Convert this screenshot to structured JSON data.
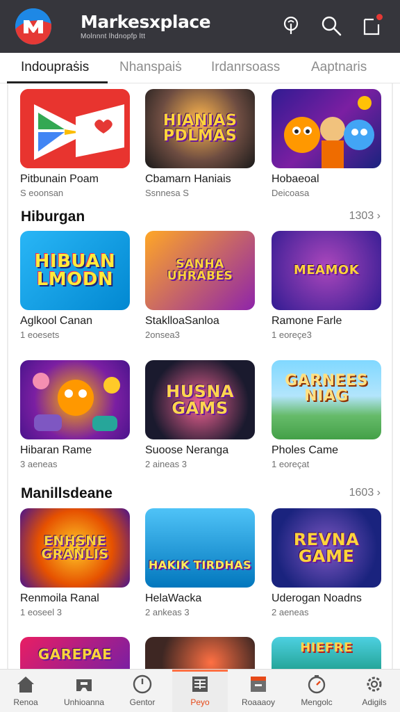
{
  "header": {
    "app_title": "Markesxplace",
    "app_subtitle": "Molnnnt lhdnopfp ltt",
    "icons": [
      "logo-icon",
      "pin-icon",
      "search-icon",
      "notification-icon"
    ]
  },
  "tabs": [
    {
      "label": "Indoupraṡis",
      "active": true
    },
    {
      "label": "Nhanspaiṡ",
      "active": false
    },
    {
      "label": "Irdanrsoass",
      "active": false
    },
    {
      "label": "Aaptnaris",
      "active": false
    }
  ],
  "rows": [
    {
      "cards": [
        {
          "title": "Pitbunain Poam",
          "sub": "S eoonsan",
          "art": ""
        },
        {
          "title": "Cbamarn Haniais",
          "sub": "Ssnnesa S",
          "art": "HIANIAS PDLMAS"
        },
        {
          "title": "Hobaeoal",
          "sub": "Deicoasa",
          "art": ""
        }
      ]
    },
    {
      "section": {
        "title": "Hiburgan",
        "more": "1303 ›"
      },
      "cards": [
        {
          "title": "Aglkool Canan",
          "sub": "1 eoesets",
          "art": "HIBUAN LMODN"
        },
        {
          "title": "StaklloaSanloa",
          "sub": "2onsea3",
          "art": "SANHA UHRABES"
        },
        {
          "title": "Ramone Farle",
          "sub": "1 eoreçe3",
          "art": "MEAMOK"
        }
      ]
    },
    {
      "cards": [
        {
          "title": "Hibaran Rame",
          "sub": "3 aeneas",
          "art": ""
        },
        {
          "title": "Suoose Neranga",
          "sub": "2 aineas 3",
          "art": "HUSNA GAMS"
        },
        {
          "title": "Pholes Came",
          "sub": "1 eoreçat",
          "art": "GARNEES NIAG"
        }
      ]
    },
    {
      "section": {
        "title": "Manillsdeane",
        "more": "1603 ›"
      },
      "cards": [
        {
          "title": "Renmoila Ranal",
          "sub": "1 eoseel 3",
          "art": "ENHSNE GRANLIS"
        },
        {
          "title": "HelaWacka",
          "sub": "2 ankeas 3",
          "art": "HAKIK TIRDHAS"
        },
        {
          "title": "Uderogan Noadns",
          "sub": "2 aeneas",
          "art": "REVNA GAME"
        }
      ]
    },
    {
      "cards": [
        {
          "title": "",
          "sub": "",
          "art": "GAREPAE"
        },
        {
          "title": "",
          "sub": "",
          "art": ""
        },
        {
          "title": "",
          "sub": "",
          "art": "HIEFRE"
        }
      ]
    }
  ],
  "bottom_nav": [
    {
      "label": "Renoa",
      "icon": "home-icon",
      "active": false
    },
    {
      "label": "Unhioanna",
      "icon": "controller-icon",
      "active": false
    },
    {
      "label": "Gentor",
      "icon": "clock-icon",
      "active": false
    },
    {
      "label": "Peyo",
      "icon": "list-icon",
      "active": true
    },
    {
      "label": "Roaaaoy",
      "icon": "archive-icon",
      "active": false
    },
    {
      "label": "Mengolc",
      "icon": "timer-icon",
      "active": false
    },
    {
      "label": "Adigils",
      "icon": "settings-icon",
      "active": false
    }
  ],
  "colors": {
    "header_bg": "#36363c",
    "accent": "#e64a19",
    "active_tab": "#1b1b1b"
  }
}
